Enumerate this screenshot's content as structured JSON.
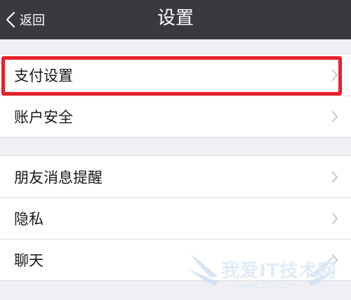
{
  "navbar": {
    "back_label": "返回",
    "title": "设置"
  },
  "groups": [
    {
      "items": [
        {
          "label": "支付设置"
        },
        {
          "label": "账户安全"
        }
      ]
    },
    {
      "items": [
        {
          "label": "朋友消息提醒"
        },
        {
          "label": "隐私"
        },
        {
          "label": "聊天"
        }
      ]
    }
  ],
  "highlight_color": "#e8202c",
  "watermark": {
    "text": "我爱IT技术网",
    "url": "www.52ij.com"
  }
}
